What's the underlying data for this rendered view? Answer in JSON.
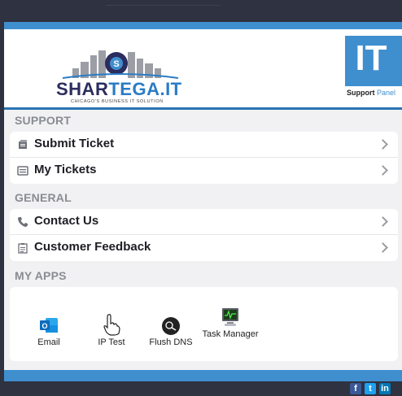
{
  "header": {
    "logo": {
      "word_dark": "SHAR",
      "word_accent": "TEGA.IT",
      "tagline": "CHICAGO'S BUSINESS IT SOLUTION"
    },
    "it_badge": {
      "text": "IT",
      "label_strong": "Support",
      "label_accent": "Panel"
    }
  },
  "sections": {
    "support": {
      "title": "SUPPORT",
      "items": [
        {
          "label": "Submit Ticket",
          "icon": "ticket-icon"
        },
        {
          "label": "My Tickets",
          "icon": "list-icon"
        }
      ]
    },
    "general": {
      "title": "GENERAL",
      "items": [
        {
          "label": "Contact Us",
          "icon": "phone-icon"
        },
        {
          "label": "Customer Feedback",
          "icon": "clipboard-icon"
        }
      ]
    },
    "apps": {
      "title": "MY APPS",
      "items": [
        {
          "label": "Email",
          "icon": "outlook-icon"
        },
        {
          "label": "IP Test",
          "icon": "hand-pointer-icon"
        },
        {
          "label": "Flush DNS",
          "icon": "dns-icon"
        },
        {
          "label": "Task Manager",
          "icon": "monitor-icon"
        }
      ]
    }
  },
  "footer": {
    "social": [
      {
        "text": "f",
        "icon": "facebook-icon"
      },
      {
        "text": "t",
        "icon": "twitter-icon"
      },
      {
        "text": "in",
        "icon": "linkedin-icon"
      }
    ]
  },
  "colors": {
    "accent": "#3f8fcf",
    "dark": "#2f3240",
    "brand_dark": "#2b2d5f",
    "panel_bg": "#f1f1f3"
  }
}
